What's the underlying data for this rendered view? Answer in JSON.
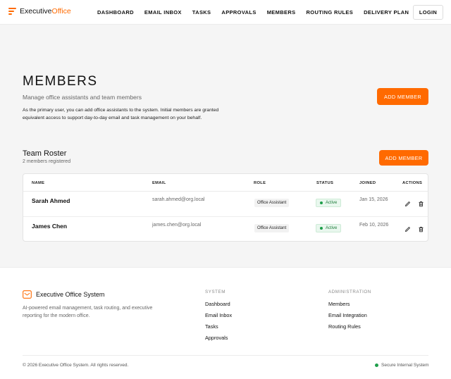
{
  "brand": {
    "name_part1": "Executive",
    "name_part2": "Office",
    "accent_color": "#ff6a00"
  },
  "nav": {
    "items": [
      "DASHBOARD",
      "EMAIL INBOX",
      "TASKS",
      "APPROVALS",
      "MEMBERS",
      "ROUTING RULES",
      "DELIVERY PLAN"
    ],
    "login_label": "LOGIN"
  },
  "hero": {
    "title": "MEMBERS",
    "subtitle": "Manage office assistants and team members",
    "description": "As the primary user, you can add office assistants to the system. Initial members are granted equivalent access to support day-to-day email and task management on your behalf.",
    "add_label": "ADD MEMBER"
  },
  "roster": {
    "title": "Team Roster",
    "count_text": "2 members registered",
    "add_label": "ADD MEMBER",
    "columns": [
      "NAME",
      "EMAIL",
      "ROLE",
      "STATUS",
      "JOINED",
      "ACTIONS"
    ],
    "rows": [
      {
        "name": "Sarah Ahmed",
        "email": "sarah.ahmed@org.local",
        "role": "Office Assistant",
        "status": "Active",
        "joined": "Jan 15, 2026"
      },
      {
        "name": "James Chen",
        "email": "james.chen@org.local",
        "role": "Office Assistant",
        "status": "Active",
        "joined": "Feb 10, 2026"
      }
    ],
    "status_color": "#1e9e4a"
  },
  "footer": {
    "brand_name": "Executive Office System",
    "tagline": "AI-powered email management, task routing, and executive reporting for the modern office.",
    "system": {
      "heading": "SYSTEM",
      "links": [
        "Dashboard",
        "Email Inbox",
        "Tasks",
        "Approvals"
      ]
    },
    "administration": {
      "heading": "ADMINISTRATION",
      "links": [
        "Members",
        "Email Integration",
        "Routing Rules"
      ]
    },
    "copyright": "© 2026 Executive Office System. All rights reserved.",
    "secure_text": "Secure Internal System"
  }
}
